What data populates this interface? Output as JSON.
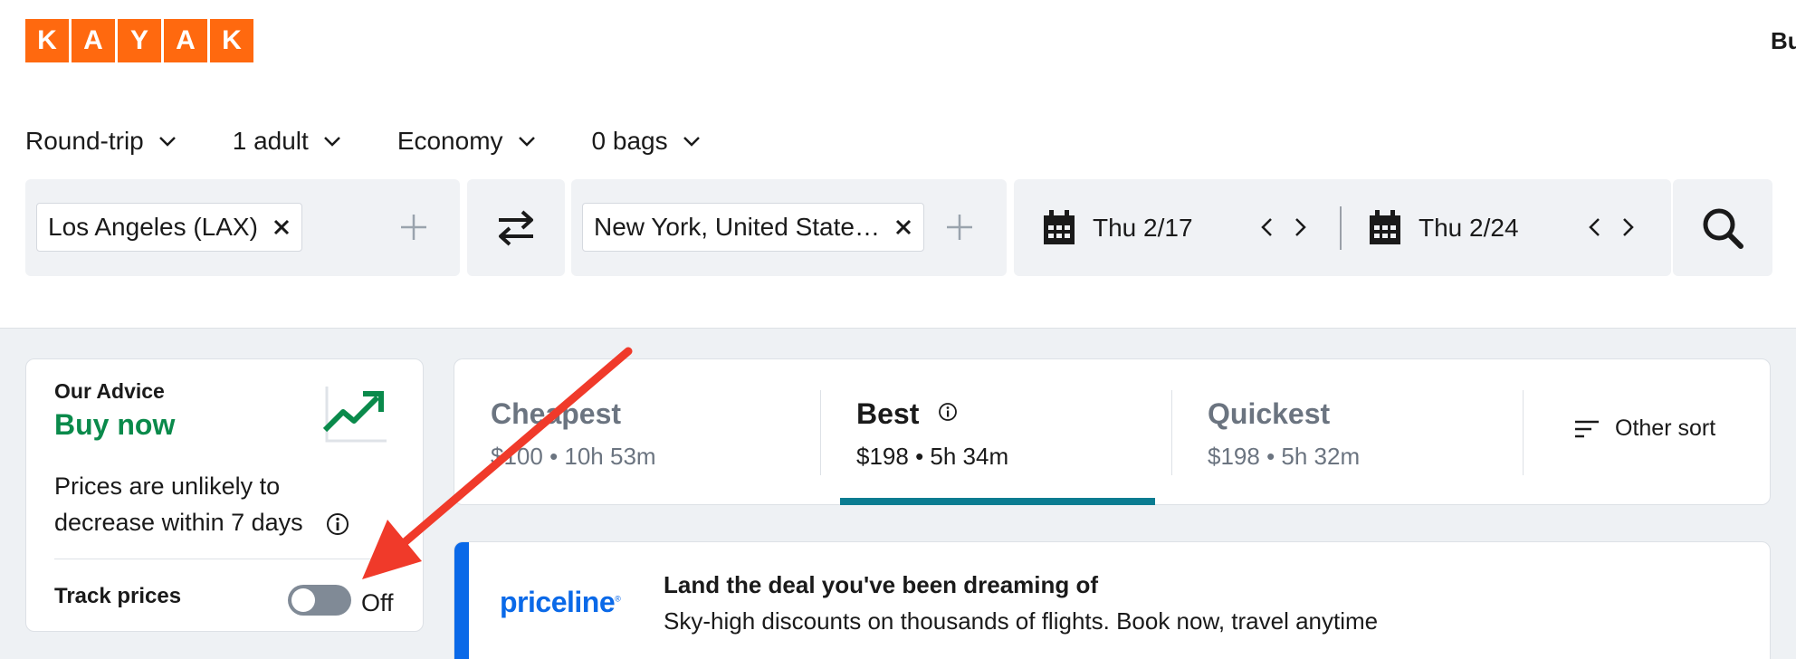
{
  "header": {
    "logo_letters": [
      "K",
      "A",
      "Y",
      "A",
      "K"
    ],
    "logo_name": "KAYAK",
    "top_right_text": "Bu",
    "brand_color": "#ff690f"
  },
  "options": {
    "trip_type": "Round-trip",
    "passengers": "1 adult",
    "cabin": "Economy",
    "bags": "0 bags"
  },
  "search": {
    "origin": "Los Angeles (LAX)",
    "destination": "New York, United State…",
    "depart_date": "Thu 2/17",
    "return_date": "Thu 2/24",
    "icons": [
      "close-icon",
      "plus-icon",
      "swap-icon",
      "calendar-icon",
      "chevron-left-icon",
      "chevron-right-icon",
      "search-icon"
    ]
  },
  "advice": {
    "label": "Our Advice",
    "value": "Buy now",
    "value_color": "#0a8a4b",
    "description": "Prices are unlikely to decrease within 7 days",
    "track_label": "Track prices",
    "track_state": "Off"
  },
  "sort": {
    "tabs": [
      {
        "title": "Cheapest",
        "sub": "$100 • 10h 53m",
        "selected": false
      },
      {
        "title": "Best",
        "sub": "$198 • 5h 34m",
        "selected": true
      },
      {
        "title": "Quickest",
        "sub": "$198 • 5h 32m",
        "selected": false
      }
    ],
    "other_label": "Other sort",
    "accent_color": "#0a7c91"
  },
  "ad": {
    "logo_text": "priceline",
    "logo_mark": "®",
    "headline": "Land the deal you've been dreaming of",
    "body": "Sky-high discounts on thousands of flights. Book now, travel anytime",
    "accent_color": "#0a69e8"
  },
  "annotation": {
    "arrow_color": "#f03a2a"
  }
}
